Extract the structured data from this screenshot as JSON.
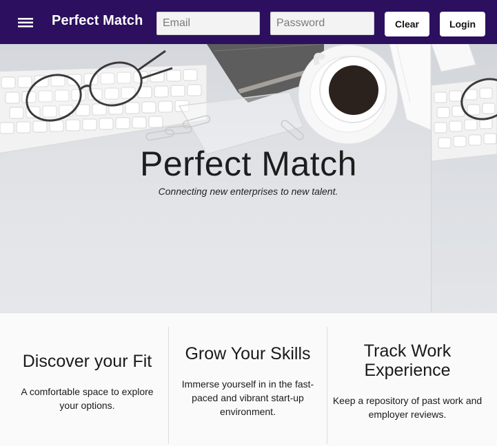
{
  "header": {
    "brand": "Perfect Match",
    "email_placeholder": "Email",
    "password_placeholder": "Password",
    "clear_label": "Clear",
    "login_label": "Login",
    "background_color": "#2c0f5e"
  },
  "hero": {
    "title": "Perfect Match",
    "subtitle": "Connecting new enterprises to new talent."
  },
  "features": [
    {
      "title": "Discover your Fit",
      "description": "A comfortable space to explore your options."
    },
    {
      "title": "Grow Your Skills",
      "description": "Immerse yourself in in the fast-paced and vibrant start-up environment."
    },
    {
      "title": "Track Work Experience",
      "description": "Keep a repository of past work and employer reviews."
    }
  ]
}
